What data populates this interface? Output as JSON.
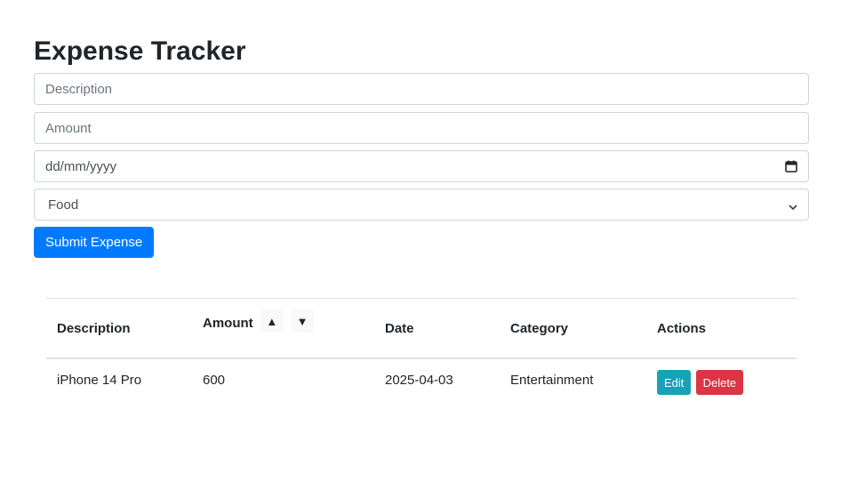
{
  "page": {
    "title": "Expense Tracker"
  },
  "form": {
    "description": {
      "placeholder": "Description",
      "value": ""
    },
    "amount": {
      "placeholder": "Amount",
      "value": ""
    },
    "date": {
      "placeholder": "dd/mm/yyyy",
      "value": ""
    },
    "category": {
      "selected": "Food"
    },
    "submit_label": "Submit Expense"
  },
  "table": {
    "headers": {
      "description": "Description",
      "amount": "Amount",
      "date": "Date",
      "category": "Category",
      "actions": "Actions"
    },
    "sort": {
      "asc_symbol": "▲",
      "desc_symbol": "▼"
    },
    "rows": [
      {
        "description": "iPhone 14 Pro",
        "amount": "600",
        "date": "2025-04-03",
        "category": "Entertainment",
        "edit_label": "Edit",
        "delete_label": "Delete"
      }
    ]
  },
  "colors": {
    "primary": "#007bff",
    "info": "#17a2b8",
    "danger": "#dc3545"
  },
  "icons": {
    "date": "calendar-icon",
    "select": "chevron-down-icon"
  }
}
